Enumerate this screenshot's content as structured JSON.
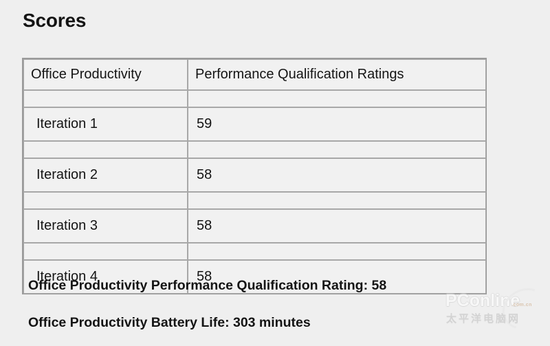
{
  "page": {
    "title": "Scores",
    "background_color": "#efefef",
    "text_color": "#141414"
  },
  "scores_table": {
    "columns": [
      "Office Productivity",
      "Performance Qualification Ratings"
    ],
    "rows": [
      {
        "label": "Iteration 1",
        "value": "59"
      },
      {
        "label": "Iteration 2",
        "value": "58"
      },
      {
        "label": "Iteration 3",
        "value": "58"
      },
      {
        "label": "Iteration 4",
        "value": "58"
      }
    ],
    "border_color": "#a8a8a8",
    "cell_background": "#f1f1f1"
  },
  "summary": {
    "rating_line": "Office Productivity Performance Qualification Rating: 58",
    "battery_line": "Office Productivity Battery Life: 303 minutes"
  },
  "watermark": {
    "brand": "PConline",
    "domain": ".com.cn",
    "chinese": "太平洋电脑网"
  }
}
